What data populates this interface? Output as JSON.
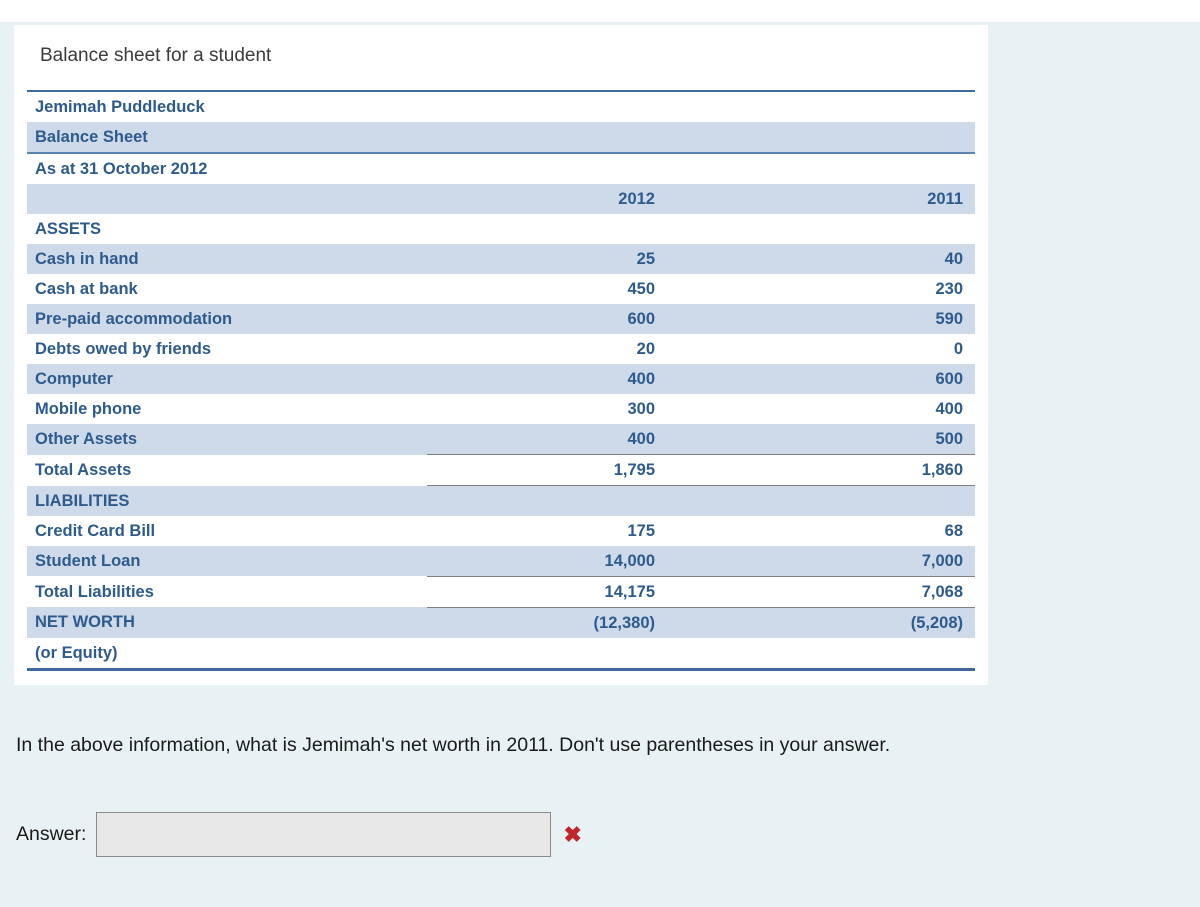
{
  "card": {
    "title": "Balance sheet for a student"
  },
  "statement": {
    "entity_name": "Jemimah Puddleduck",
    "doc_type": "Balance Sheet",
    "as_at": "As at 31 October 2012",
    "columns": [
      "",
      "2012",
      "2011"
    ],
    "rows": [
      {
        "label": "ASSETS",
        "v2012": "",
        "v2011": "",
        "kind": "section",
        "shade": false
      },
      {
        "label": "Cash in hand",
        "v2012": "25",
        "v2011": "40",
        "kind": "item",
        "shade": true
      },
      {
        "label": "Cash at bank",
        "v2012": "450",
        "v2011": "230",
        "kind": "item",
        "shade": false
      },
      {
        "label": "Pre-paid accommodation",
        "v2012": "600",
        "v2011": "590",
        "kind": "item",
        "shade": true
      },
      {
        "label": "Debts owed by friends",
        "v2012": "20",
        "v2011": "0",
        "kind": "item",
        "shade": false
      },
      {
        "label": "Computer",
        "v2012": "400",
        "v2011": "600",
        "kind": "item",
        "shade": true
      },
      {
        "label": "Mobile phone",
        "v2012": "300",
        "v2011": "400",
        "kind": "item",
        "shade": false
      },
      {
        "label": "Other Assets",
        "v2012": "400",
        "v2011": "500",
        "kind": "item",
        "shade": true
      },
      {
        "label": "Total Assets",
        "v2012": "1,795",
        "v2011": "1,860",
        "kind": "total",
        "shade": false
      },
      {
        "label": "LIABILITIES",
        "v2012": "",
        "v2011": "",
        "kind": "section",
        "shade": true
      },
      {
        "label": "Credit Card Bill",
        "v2012": "175",
        "v2011": "68",
        "kind": "item",
        "shade": false
      },
      {
        "label": "Student Loan",
        "v2012": "14,000",
        "v2011": "7,000",
        "kind": "item",
        "shade": true
      },
      {
        "label": "Total Liabilities",
        "v2012": "14,175",
        "v2011": "7,068",
        "kind": "total",
        "shade": false
      },
      {
        "label": "NET WORTH",
        "v2012": "(12,380)",
        "v2011": "(5,208)",
        "kind": "netcap",
        "shade": true
      },
      {
        "label": "(or Equity)",
        "v2012": "",
        "v2011": "",
        "kind": "netsub",
        "shade": false
      }
    ]
  },
  "question": {
    "text": "In the above information, what is Jemimah's net worth in 2011.  Don't use parentheses in your answer."
  },
  "answer": {
    "label": "Answer:",
    "value": "",
    "placeholder": "",
    "result_icon": "cross-mark-icon",
    "result_glyph": "✖",
    "result_color": "#c0272d"
  }
}
